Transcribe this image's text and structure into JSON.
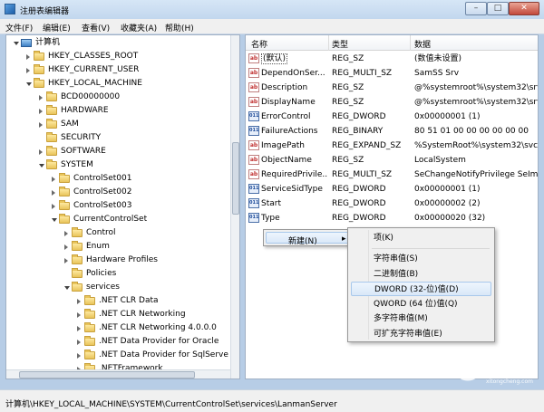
{
  "window": {
    "title": "注册表编辑器",
    "minimize": "–",
    "maximize": "□",
    "close": "✕"
  },
  "menu": [
    "文件(F)",
    "编辑(E)",
    "查看(V)",
    "收藏夹(A)",
    "帮助(H)"
  ],
  "tree": {
    "items": [
      {
        "label": "计算机",
        "icon": "computer-icon",
        "arrow": "open"
      },
      {
        "label": "HKEY_CLASSES_ROOT",
        "icon": "folder-icon",
        "arrow": "closed"
      },
      {
        "label": "HKEY_CURRENT_USER",
        "icon": "folder-icon",
        "arrow": "closed"
      },
      {
        "label": "HKEY_LOCAL_MACHINE",
        "icon": "folder-icon",
        "arrow": "open"
      },
      {
        "label": "BCD00000000",
        "icon": "folder-icon",
        "arrow": "closed"
      },
      {
        "label": "HARDWARE",
        "icon": "folder-icon",
        "arrow": "closed"
      },
      {
        "label": "SAM",
        "icon": "folder-icon",
        "arrow": "closed"
      },
      {
        "label": "SECURITY",
        "icon": "folder-icon",
        "arrow": "none"
      },
      {
        "label": "SOFTWARE",
        "icon": "folder-icon",
        "arrow": "closed"
      },
      {
        "label": "SYSTEM",
        "icon": "folder-icon",
        "arrow": "open"
      },
      {
        "label": "ControlSet001",
        "icon": "folder-icon",
        "arrow": "closed"
      },
      {
        "label": "ControlSet002",
        "icon": "folder-icon",
        "arrow": "closed"
      },
      {
        "label": "ControlSet003",
        "icon": "folder-icon",
        "arrow": "closed"
      },
      {
        "label": "CurrentControlSet",
        "icon": "folder-icon",
        "arrow": "open"
      },
      {
        "label": "Control",
        "icon": "folder-icon",
        "arrow": "closed"
      },
      {
        "label": "Enum",
        "icon": "folder-icon",
        "arrow": "closed"
      },
      {
        "label": "Hardware Profiles",
        "icon": "folder-icon",
        "arrow": "closed"
      },
      {
        "label": "Policies",
        "icon": "folder-icon",
        "arrow": "none"
      },
      {
        "label": "services",
        "icon": "folder-icon",
        "arrow": "open"
      },
      {
        "label": ".NET CLR Data",
        "icon": "folder-icon",
        "arrow": "closed"
      },
      {
        "label": ".NET CLR Networking",
        "icon": "folder-icon",
        "arrow": "closed"
      },
      {
        "label": ".NET CLR Networking 4.0.0.0",
        "icon": "folder-icon",
        "arrow": "closed"
      },
      {
        "label": ".NET Data Provider for Oracle",
        "icon": "folder-icon",
        "arrow": "closed"
      },
      {
        "label": ".NET Data Provider for SqlServe",
        "icon": "folder-icon",
        "arrow": "closed"
      },
      {
        "label": ".NETFramework",
        "icon": "folder-icon",
        "arrow": "closed"
      }
    ]
  },
  "list": {
    "headers": [
      "名称",
      "类型",
      "数据"
    ],
    "rows": [
      {
        "name": "(默认)",
        "type": "REG_SZ",
        "data": "(数值未设置)",
        "icon": "string-value-icon"
      },
      {
        "name": "DependOnSer...",
        "type": "REG_MULTI_SZ",
        "data": "SamSS Srv",
        "icon": "string-value-icon"
      },
      {
        "name": "Description",
        "type": "REG_SZ",
        "data": "@%systemroot%\\system32\\srv",
        "icon": "string-value-icon"
      },
      {
        "name": "DisplayName",
        "type": "REG_SZ",
        "data": "@%systemroot%\\system32\\srv",
        "icon": "string-value-icon"
      },
      {
        "name": "ErrorControl",
        "type": "REG_DWORD",
        "data": "0x00000001 (1)",
        "icon": "binary-value-icon"
      },
      {
        "name": "FailureActions",
        "type": "REG_BINARY",
        "data": "80 51 01 00 00 00 00 00 00",
        "icon": "binary-value-icon"
      },
      {
        "name": "ImagePath",
        "type": "REG_EXPAND_SZ",
        "data": "%SystemRoot%\\system32\\svch",
        "icon": "string-value-icon"
      },
      {
        "name": "ObjectName",
        "type": "REG_SZ",
        "data": "LocalSystem",
        "icon": "string-value-icon"
      },
      {
        "name": "RequiredPrivile...",
        "type": "REG_MULTI_SZ",
        "data": "SeChangeNotifyPrivilege SeImp",
        "icon": "string-value-icon"
      },
      {
        "name": "ServiceSidType",
        "type": "REG_DWORD",
        "data": "0x00000001 (1)",
        "icon": "binary-value-icon"
      },
      {
        "name": "Start",
        "type": "REG_DWORD",
        "data": "0x00000002 (2)",
        "icon": "binary-value-icon"
      },
      {
        "name": "Type",
        "type": "REG_DWORD",
        "data": "0x00000020 (32)",
        "icon": "binary-value-icon"
      }
    ]
  },
  "context_menu": {
    "new_label": "新建(N)",
    "arrow": "▸"
  },
  "submenu": {
    "key": "项(K)",
    "items": [
      "字符串值(S)",
      "二进制值(B)",
      "DWORD (32-位)值(D)",
      "QWORD (64 位)值(Q)",
      "多字符串值(M)",
      "可扩充字符串值(E)"
    ],
    "highlighted_index": 2
  },
  "status": {
    "path": "计算机\\HKEY_LOCAL_MACHINE\\SYSTEM\\CurrentControlSet\\services\\LanmanServer"
  },
  "watermark": {
    "brand": "系统城",
    "site": "xitongcheng.com"
  }
}
